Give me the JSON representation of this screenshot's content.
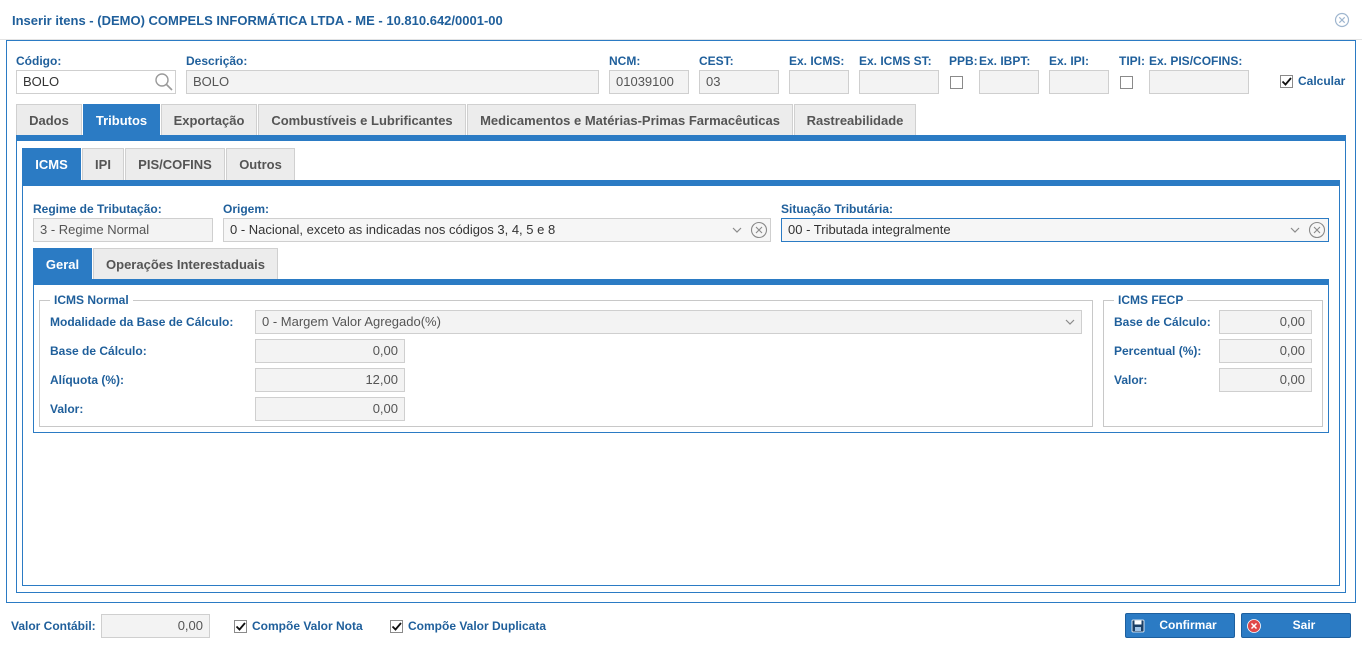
{
  "window": {
    "title": "Inserir itens - (DEMO) COMPELS INFORMÁTICA LTDA - ME - 10.810.642/0001-00"
  },
  "header": {
    "codigo_label": "Código:",
    "codigo_value": "BOLO",
    "descricao_label": "Descrição:",
    "descricao_value": "BOLO",
    "ncm_label": "NCM:",
    "ncm_value": "01039100",
    "cest_label": "CEST:",
    "cest_value": "03",
    "ex_icms_label": "Ex. ICMS:",
    "ex_icms_st_label": "Ex. ICMS ST:",
    "ppb_label": "PPB:",
    "ex_ibpt_label": "Ex. IBPT:",
    "ex_ipi_label": "Ex. IPI:",
    "tipi_label": "TIPI:",
    "ex_pis_label": "Ex. PIS/COFINS:",
    "calcular_label": "Calcular"
  },
  "main_tabs": [
    "Dados",
    "Tributos",
    "Exportação",
    "Combustíveis e Lubrificantes",
    "Medicamentos e Matérias-Primas Farmacêuticas",
    "Rastreabilidade"
  ],
  "sub_tabs": [
    "ICMS",
    "IPI",
    "PIS/COFINS",
    "Outros"
  ],
  "icms": {
    "regime_label": "Regime de Tributação:",
    "regime_value": "3 - Regime Normal",
    "origem_label": "Origem:",
    "origem_value": "0 - Nacional, exceto as indicadas nos códigos 3, 4, 5 e 8",
    "situacao_label": "Situação Tributária:",
    "situacao_value": "00 - Tributada integralmente"
  },
  "inner_tabs": [
    "Geral",
    "Operações Interestaduais"
  ],
  "icms_normal": {
    "legend": "ICMS Normal",
    "modalidade_label": "Modalidade da Base de Cálculo:",
    "modalidade_value": "0 - Margem Valor Agregado(%)",
    "base_label": "Base de Cálculo:",
    "base_value": "0,00",
    "aliquota_label": "Alíquota (%):",
    "aliquota_value": "12,00",
    "valor_label": "Valor:",
    "valor_value": "0,00"
  },
  "icms_fecp": {
    "legend": "ICMS FECP",
    "base_label": "Base de Cálculo:",
    "base_value": "0,00",
    "percentual_label": "Percentual (%):",
    "percentual_value": "0,00",
    "valor_label": "Valor:",
    "valor_value": "0,00"
  },
  "footer": {
    "valor_contabil_label": "Valor Contábil:",
    "valor_contabil_value": "0,00",
    "compoe_nota_label": "Compõe Valor Nota",
    "compoe_duplicata_label": "Compõe Valor Duplicata",
    "confirmar_label": "Confirmar",
    "sair_label": "Sair"
  },
  "colors": {
    "accent": "#2b7bc4",
    "label": "#1f5f9b",
    "sair_icon": "#e04848"
  },
  "icons": [
    "close-circle-icon",
    "search-icon",
    "chevron-down-icon",
    "clear-circle-icon",
    "checkmark-icon",
    "save-icon",
    "exit-icon"
  ]
}
